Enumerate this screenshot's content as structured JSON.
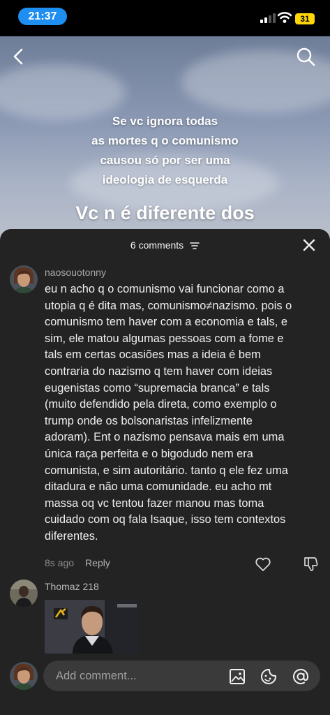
{
  "status_bar": {
    "time": "21:37",
    "battery": "31"
  },
  "video": {
    "overlay_lines": [
      "Se vc ignora todas",
      "as mortes q o comunismo",
      "causou só por ser uma",
      "ideologia de esquerda"
    ],
    "overlay_big": "Vc n é diferente dos"
  },
  "sheet": {
    "count_label": "6 comments"
  },
  "comments": [
    {
      "username": "naosouotonny",
      "lines": [
        "eu n acho q o comunismo vai funcionar como a",
        "utopia q é dita mas, comunismo≠nazismo. pois o",
        "comunismo tem haver com a economia e tals, e",
        "sim, ele matou algumas pessoas com a fome e",
        "tals em certas ocasiões mas a ideia é bem",
        "contraria do nazismo q tem haver com ideias",
        "eugenistas como “supremacia branca” e tals",
        "(muito defendido pela direta, como exemplo o",
        "trump onde os bolsonaristas infelizmente",
        "adoram). Ent o nazismo pensava mais em uma",
        "única raça perfeita e o bigodudo nem era",
        "comunista, e sim autoritário. tanto q ele fez uma",
        "ditadura e não uma comunidade. eu acho mt",
        "massa oq vc tentou fazer manou mas toma",
        "cuidado com oq fala Isaque, isso tem contextos",
        "diferentes."
      ],
      "time": "8s ago",
      "reply_label": "Reply"
    },
    {
      "username": "Thomaz 218"
    }
  ],
  "composer": {
    "placeholder": "Add comment..."
  },
  "icons": {
    "back": "back-arrow-icon",
    "search": "search-icon",
    "close": "close-icon",
    "sort": "sort-icon",
    "like": "heart-icon",
    "dislike": "dislike-icon",
    "image": "image-icon",
    "sticker": "sticker-icon",
    "mention": "at-icon"
  },
  "colors": {
    "sheet_bg": "#232323",
    "time_pill": "#1f8ef1",
    "battery": "#ffd60a"
  }
}
